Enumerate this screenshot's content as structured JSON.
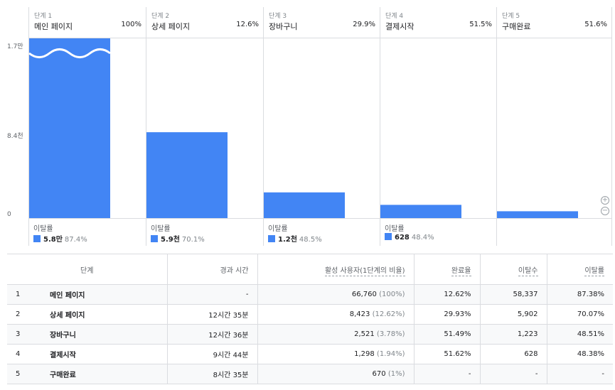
{
  "chart_data": {
    "type": "bar",
    "y_ticks": [
      "1.7만",
      "8.4천",
      "0"
    ],
    "ylim": [
      0,
      17000
    ],
    "steps": [
      {
        "label": "단계 1",
        "name": "메인 페이지",
        "pct": "100%",
        "value": 66760,
        "abandon_label": "이탈률",
        "abandon_value": "5.8만",
        "abandon_rate": "87.4%"
      },
      {
        "label": "단계 2",
        "name": "상세 페이지",
        "pct": "12.6%",
        "value": 8423,
        "abandon_label": "이탈률",
        "abandon_value": "5.9천",
        "abandon_rate": "70.1%"
      },
      {
        "label": "단계 3",
        "name": "장바구니",
        "pct": "29.9%",
        "value": 2521,
        "abandon_label": "이탈률",
        "abandon_value": "1.2천",
        "abandon_rate": "48.5%"
      },
      {
        "label": "단계 4",
        "name": "결제시작",
        "pct": "51.5%",
        "value": 1298,
        "abandon_label": "이탈률",
        "abandon_value": "628",
        "abandon_rate": "48.4%"
      },
      {
        "label": "단계 5",
        "name": "구매완료",
        "pct": "51.6%",
        "value": 670,
        "abandon_label": "",
        "abandon_value": "",
        "abandon_rate": ""
      }
    ],
    "bar_color": "#4285f4"
  },
  "zoom": {
    "in_icon": "zoom-in-icon",
    "out_icon": "zoom-out-icon",
    "in_glyph": "+",
    "out_glyph": "−"
  },
  "table": {
    "headers": {
      "step": "단계",
      "elapsed": "경과 시간",
      "active_users": "활성 사용자(1단계의 비율)",
      "completion": "완료율",
      "abandonments": "이탈수",
      "abandon_rate": "이탈률"
    },
    "rows": [
      {
        "idx": "1",
        "name": "메인 페이지",
        "elapsed": "-",
        "users": "66,760",
        "users_pct": "(100%)",
        "completion": "12.62%",
        "abandonments": "58,337",
        "abandon_rate": "87.38%"
      },
      {
        "idx": "2",
        "name": "상세 페이지",
        "elapsed": "12시간 35분",
        "users": "8,423",
        "users_pct": "(12.62%)",
        "completion": "29.93%",
        "abandonments": "5,902",
        "abandon_rate": "70.07%"
      },
      {
        "idx": "3",
        "name": "장바구니",
        "elapsed": "12시간 36분",
        "users": "2,521",
        "users_pct": "(3.78%)",
        "completion": "51.49%",
        "abandonments": "1,223",
        "abandon_rate": "48.51%"
      },
      {
        "idx": "4",
        "name": "결제시작",
        "elapsed": "9시간 44분",
        "users": "1,298",
        "users_pct": "(1.94%)",
        "completion": "51.62%",
        "abandonments": "628",
        "abandon_rate": "48.38%"
      },
      {
        "idx": "5",
        "name": "구매완료",
        "elapsed": "8시간 35분",
        "users": "670",
        "users_pct": "(1%)",
        "completion": "-",
        "abandonments": "-",
        "abandon_rate": "-"
      }
    ]
  }
}
